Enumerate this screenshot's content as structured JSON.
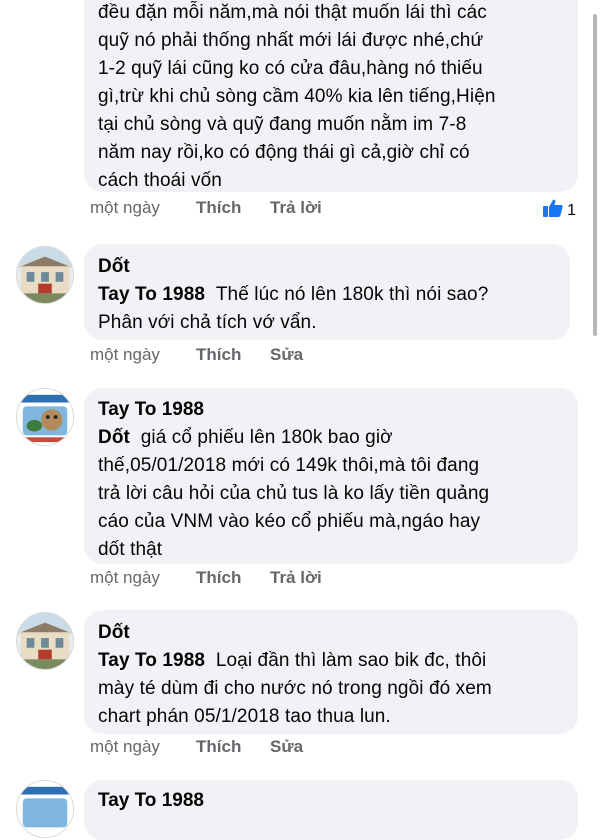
{
  "comments": [
    {
      "text": "đều đặn mỗi năm,mà nói thật muốn lái thì các\nquỹ nó phải thống nhất mới lái được nhé,chứ\n1-2 quỹ lái cũng ko có cửa đâu,hàng nó thiếu\ngì,trừ khi chủ sòng cầm 40% kia lên tiếng,Hiện\ntại chủ sòng và quỹ đang muốn nằm im 7-8\nnăm nay rồi,ko có động thái gì cả,giờ chỉ có\ncách thoái vốn",
      "time": "một ngày",
      "like": "Thích",
      "reply": "Trả lời",
      "reaction_count": "1"
    },
    {
      "author": "Dốt",
      "mention": "Tay To 1988",
      "text": "Thế lúc nó lên 180k thì nói sao?\nPhân với chả tích vớ vẩn.",
      "time": "một ngày",
      "like": "Thích",
      "reply": "Sửa"
    },
    {
      "author": "Tay To 1988",
      "mention": "Dốt",
      "text": "giá cổ phiếu lên 180k bao giờ\nthế,05/01/2018 mới có 149k thôi,mà tôi đang\ntrả lời câu hỏi của chủ tus là ko lấy tiền quảng\ncáo của VNM vào kéo cổ phiếu mà,ngáo hay\ndốt thật",
      "time": "một ngày",
      "like": "Thích",
      "reply": "Trả lời"
    },
    {
      "author": "Dốt",
      "mention": "Tay To 1988",
      "text": "Loại đần thì làm sao bik đc, thôi\nmày té dùm đi cho nước nó trong ngồi đó xem\nchart phán 05/1/2018 tao thua lun.",
      "time": "một ngày",
      "like": "Thích",
      "reply": "Sửa"
    },
    {
      "author": "Tay To 1988"
    }
  ],
  "colors": {
    "bubble": "#f0f2f5",
    "meta": "#65676b",
    "like_blue": "#1877f2"
  }
}
